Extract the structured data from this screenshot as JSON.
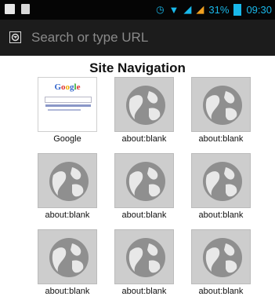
{
  "status_bar": {
    "battery_percent": "31%",
    "time": "09:30"
  },
  "url_bar": {
    "placeholder": "Search or type URL"
  },
  "page": {
    "title": "Site Navigation"
  },
  "tiles": [
    {
      "label": "Google"
    },
    {
      "label": "about:blank"
    },
    {
      "label": "about:blank"
    },
    {
      "label": "about:blank"
    },
    {
      "label": "about:blank"
    },
    {
      "label": "about:blank"
    },
    {
      "label": "about:blank"
    },
    {
      "label": "about:blank"
    },
    {
      "label": "about:blank"
    }
  ],
  "google_thumb": {
    "logo": "Google"
  },
  "colors": {
    "status_icon": "#19b8ea",
    "url_bar_bg": "#1c1c1c",
    "tile_bg": "#cdcdcd"
  }
}
